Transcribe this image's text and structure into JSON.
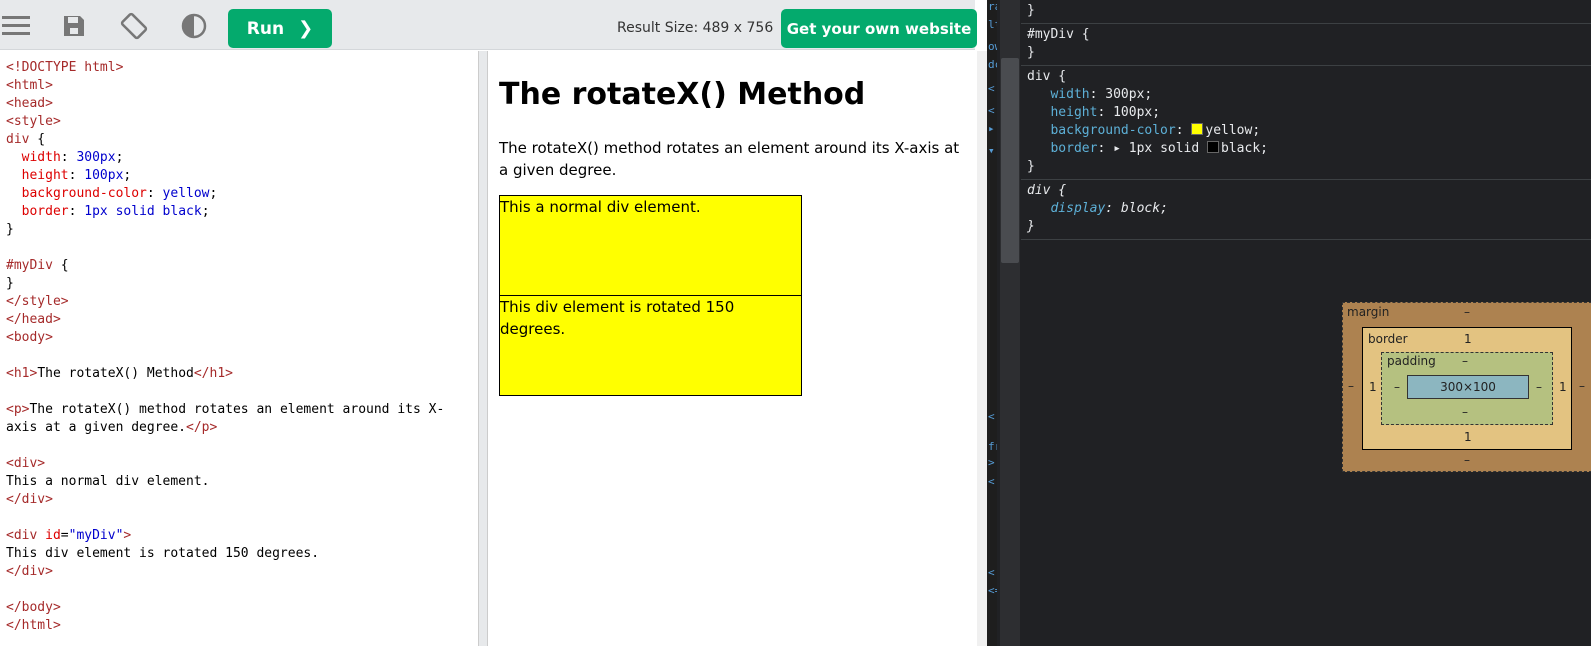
{
  "toolbar": {
    "run_label": "Run",
    "run_chevron": "❯",
    "result_size": "Result Size: 489 x 756",
    "get_website_label": "Get your own website",
    "icons": [
      "menu-icon",
      "save-icon",
      "rotate-icon",
      "theme-contrast-icon"
    ]
  },
  "editor": {
    "lines": [
      [
        [
          "t",
          "<!DOCTYPE html>"
        ]
      ],
      [
        [
          "t",
          "<html>"
        ]
      ],
      [
        [
          "t",
          "<head>"
        ]
      ],
      [
        [
          "t",
          "<style>"
        ]
      ],
      [
        [
          "t",
          "div"
        ],
        [
          "pl",
          " {"
        ]
      ],
      [
        [
          "pl",
          "  "
        ],
        [
          "p",
          "width"
        ],
        [
          "pl",
          ": "
        ],
        [
          "v",
          "300px"
        ],
        [
          "pl",
          ";"
        ]
      ],
      [
        [
          "pl",
          "  "
        ],
        [
          "p",
          "height"
        ],
        [
          "pl",
          ": "
        ],
        [
          "v",
          "100px"
        ],
        [
          "pl",
          ";"
        ]
      ],
      [
        [
          "pl",
          "  "
        ],
        [
          "p",
          "background-color"
        ],
        [
          "pl",
          ": "
        ],
        [
          "v",
          "yellow"
        ],
        [
          "pl",
          ";"
        ]
      ],
      [
        [
          "pl",
          "  "
        ],
        [
          "p",
          "border"
        ],
        [
          "pl",
          ": "
        ],
        [
          "v",
          "1px solid black"
        ],
        [
          "pl",
          ";"
        ]
      ],
      [
        [
          "pl",
          "}"
        ]
      ],
      [
        [
          "pl",
          ""
        ]
      ],
      [
        [
          "t",
          "#myDiv"
        ],
        [
          "pl",
          " {"
        ]
      ],
      [
        [
          "pl",
          "}"
        ]
      ],
      [
        [
          "t",
          "</style>"
        ]
      ],
      [
        [
          "t",
          "</head>"
        ]
      ],
      [
        [
          "t",
          "<body>"
        ]
      ],
      [
        [
          "pl",
          ""
        ]
      ],
      [
        [
          "t",
          "<h1>"
        ],
        [
          "pl",
          "The rotateX() Method"
        ],
        [
          "t",
          "</h1>"
        ]
      ],
      [
        [
          "pl",
          ""
        ]
      ],
      [
        [
          "t",
          "<p>"
        ],
        [
          "pl",
          "The rotateX() method rotates an element around its X-"
        ]
      ],
      [
        [
          "pl",
          "axis at a given degree."
        ],
        [
          "t",
          "</p>"
        ]
      ],
      [
        [
          "pl",
          ""
        ]
      ],
      [
        [
          "t",
          "<div>"
        ]
      ],
      [
        [
          "pl",
          "This a normal div element."
        ]
      ],
      [
        [
          "t",
          "</div>"
        ]
      ],
      [
        [
          "pl",
          ""
        ]
      ],
      [
        [
          "t",
          "<div "
        ],
        [
          "a",
          "id"
        ],
        [
          "pl",
          "="
        ],
        [
          "s",
          "\"myDiv\""
        ],
        [
          "t",
          ">"
        ]
      ],
      [
        [
          "pl",
          "This div element is rotated 150 degrees."
        ]
      ],
      [
        [
          "t",
          "</div>"
        ]
      ],
      [
        [
          "pl",
          ""
        ]
      ],
      [
        [
          "t",
          "</body>"
        ]
      ],
      [
        [
          "t",
          "</html>"
        ]
      ]
    ]
  },
  "result": {
    "heading": "The rotateX() Method",
    "paragraph": "The rotateX() method rotates an element around its X-axis at a given degree.",
    "normal_div": "This a normal div element.",
    "rotated_div": "This div element is rotated 150 degrees."
  },
  "devtools": {
    "gutter": [
      "ra",
      "lt",
      "ow",
      "dc",
      "<",
      "<",
      "▸",
      "▾",
      "<",
      "fr",
      ">",
      "<",
      "<:",
      "<="
    ],
    "rules": [
      {
        "lines": [
          [
            [
              "val",
              "}"
            ]
          ]
        ]
      },
      {
        "lines": [
          [
            [
              "val",
              "#myDiv {"
            ]
          ],
          [
            [
              "val",
              "}"
            ]
          ]
        ]
      },
      {
        "lines": [
          [
            [
              "val",
              "div {"
            ]
          ],
          [
            [
              "val",
              "   "
            ],
            [
              "prop",
              "width"
            ],
            [
              "val",
              ": 300px;"
            ]
          ],
          [
            [
              "val",
              "   "
            ],
            [
              "prop",
              "height"
            ],
            [
              "val",
              ": 100px;"
            ]
          ],
          [
            [
              "val",
              "   "
            ],
            [
              "prop",
              "background-color"
            ],
            [
              "val",
              ": "
            ],
            [
              "swatch",
              "#ffff00"
            ],
            [
              "val",
              "yellow;"
            ]
          ],
          [
            [
              "val",
              "   "
            ],
            [
              "prop",
              "border"
            ],
            [
              "val",
              ": ▸ 1px solid "
            ],
            [
              "swatch",
              "#000000"
            ],
            [
              "val",
              "black;"
            ]
          ],
          [
            [
              "val",
              "}"
            ]
          ]
        ]
      },
      {
        "lines": [
          [
            [
              "it",
              "div {"
            ]
          ],
          [
            [
              "it",
              "   "
            ],
            [
              "itprop",
              "display"
            ],
            [
              "it",
              ": block;"
            ]
          ],
          [
            [
              "it",
              "}"
            ]
          ]
        ]
      }
    ],
    "box_model": {
      "margin_label": "margin",
      "margin_top": "–",
      "margin_bottom": "–",
      "margin_left": "–",
      "margin_right": "–",
      "border_label": "border",
      "border_top": "1",
      "border_bottom": "1",
      "border_left": "1",
      "border_right": "1",
      "padding_label": "padding",
      "padding_top": "–",
      "padding_bottom": "–",
      "padding_left": "–",
      "padding_right": "–",
      "content": "300×100"
    }
  },
  "colors": {
    "accent": "#04aa6d",
    "swatch_yellow": "#ffff00",
    "swatch_black": "#000000"
  }
}
